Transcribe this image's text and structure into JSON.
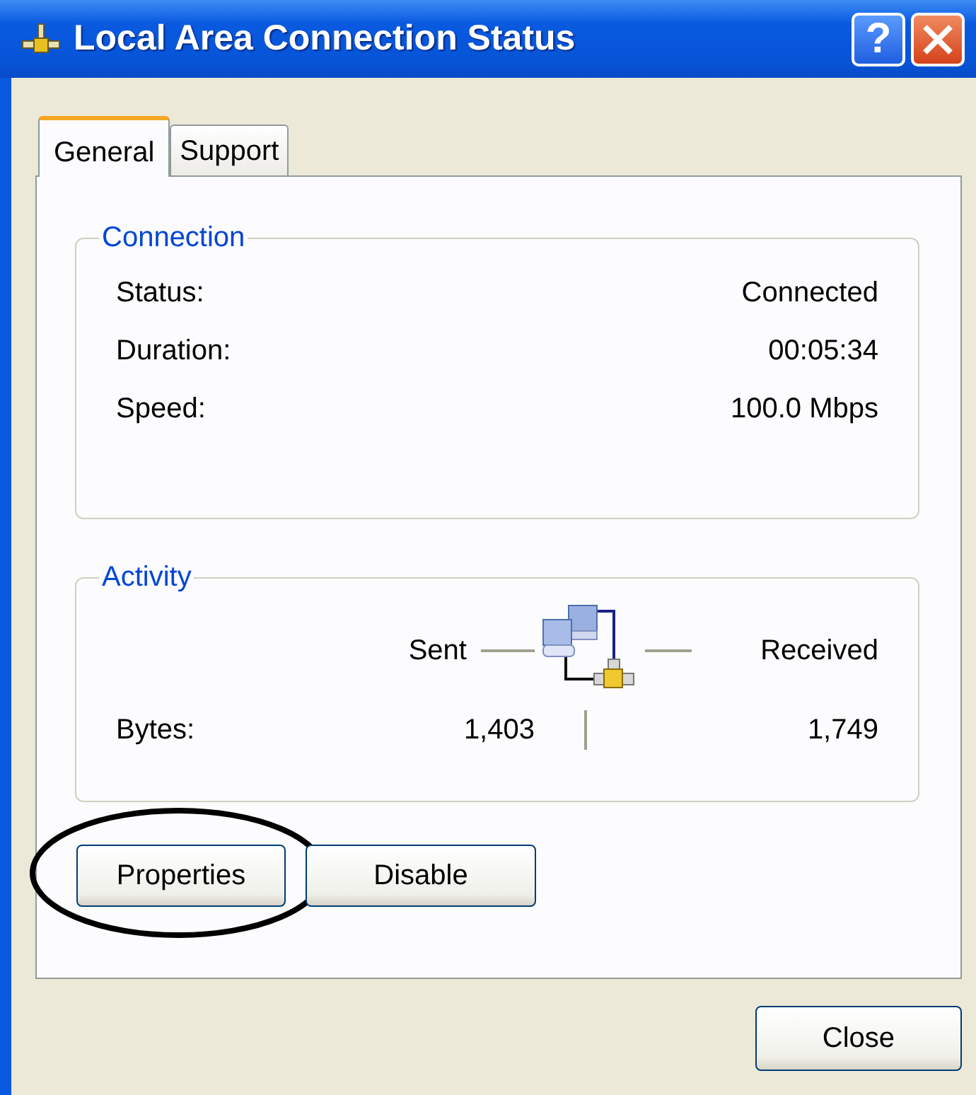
{
  "window": {
    "title": "Local Area Connection Status",
    "help_label": "?"
  },
  "tabs": [
    {
      "label": "General",
      "selected": true
    },
    {
      "label": "Support",
      "selected": false
    }
  ],
  "connection": {
    "legend": "Connection",
    "rows": [
      {
        "label": "Status:",
        "value": "Connected"
      },
      {
        "label": "Duration:",
        "value": "00:05:34"
      },
      {
        "label": "Speed:",
        "value": "100.0 Mbps"
      }
    ]
  },
  "activity": {
    "legend": "Activity",
    "sent_label": "Sent",
    "received_label": "Received",
    "bytes_label": "Bytes:",
    "bytes_sent": "1,403",
    "bytes_received": "1,749"
  },
  "buttons": [
    {
      "label": "Properties",
      "circled": true
    },
    {
      "label": "Disable",
      "circled": false
    }
  ],
  "close_button": "Close"
}
